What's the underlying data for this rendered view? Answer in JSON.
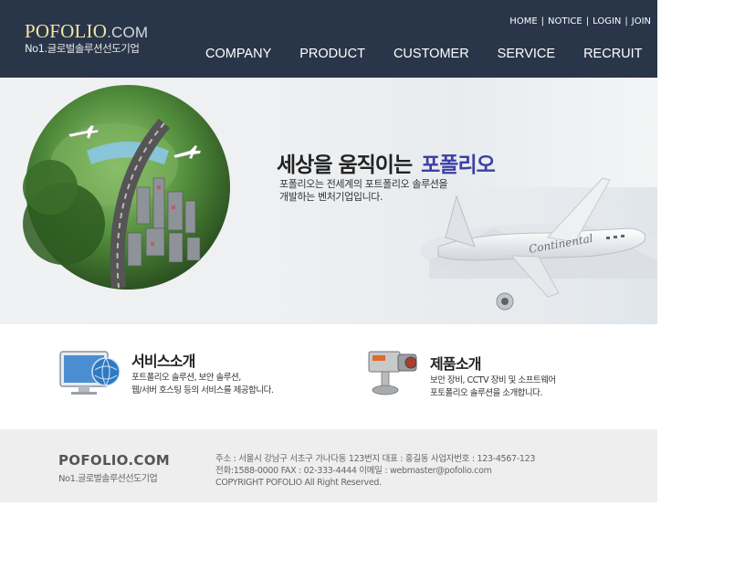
{
  "header": {
    "logo_main": "POFOLIO",
    "logo_com": ".COM",
    "logo_sub": "No1.글로벌솔루션선도기업",
    "util_links": [
      "HOME",
      "NOTICE",
      "LOGIN",
      "JOIN"
    ],
    "nav": [
      "COMPANY",
      "PRODUCT",
      "CUSTOMER",
      "SERVICE",
      "RECRUIT"
    ]
  },
  "hero": {
    "title": "세상을 움직이는",
    "brand": "포폴리오",
    "desc_line1": "포폴리오는 전세계의 포트폴리오 솔루션을",
    "desc_line2": "개발하는 벤처기업입니다.",
    "plane_text": "Continental"
  },
  "service": {
    "title": "서비스소개",
    "line1": "포트폴리오 솔루션, 보안 솔루션,",
    "line2": "웹/서버 호스팅 등의 서비스를 제공합니다."
  },
  "product": {
    "title": "제품소개",
    "line1": "보안 장비, CCTV 장비 및 소프트웨어",
    "line2": "포토폴리오 솔루션을 소개합니다."
  },
  "footer": {
    "logo": "POFOLIO.COM",
    "sub": "No1.글로벌솔루션선도기업",
    "line1": "주소 : 서울시 강남구 서초구 가나다동 123번지      대표 : 홍길동   사업자번호 : 123-4567-123",
    "line2": "전화:1588-0000      FAX : 02-333-4444    이메일 : webmaster@pofolio.com",
    "line3": "COPYRIGHT POFOLIO All Right Reserved."
  },
  "colors": {
    "header_bg": "#29364a",
    "logo_gold": "#f3e5a1",
    "brand_blue": "#3c3fa7",
    "footer_bg": "#eeeeee"
  }
}
